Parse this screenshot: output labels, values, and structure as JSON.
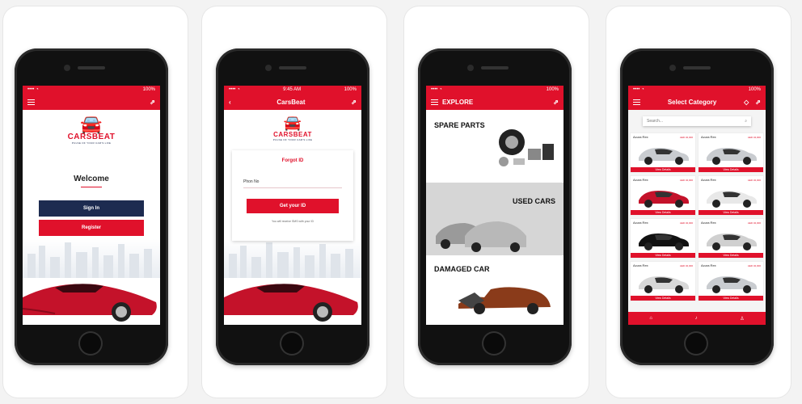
{
  "status": {
    "time": "9:45 AM",
    "battery": "100%"
  },
  "screen1": {
    "brand": "CARSBEAT",
    "tagline": "PULSE OF YOUR CAR'S LIFE",
    "welcome": "Welcome",
    "sign_in": "Sign In",
    "register": "Register"
  },
  "screen2": {
    "title": "CarsBeat",
    "form_title": "Forgot ID",
    "phone_placeholder": "Phon No",
    "submit": "Get your ID",
    "note": "You will receive SMS with your ID"
  },
  "screen3": {
    "title": "EXPLORE",
    "spare": "SPARE PARTS",
    "used": "USED CARS",
    "damaged": "DAMAGED CAR"
  },
  "screen4": {
    "title": "Select Category",
    "search_placeholder": "Search...",
    "view_label": "View Details",
    "cars": [
      {
        "name": "Acura Rex",
        "price": "AED 32,000",
        "color": "#c9ccd0"
      },
      {
        "name": "Acura Rex",
        "price": "AED 34,000",
        "color": "#c9ccd0"
      },
      {
        "name": "Acura Rex",
        "price": "AED 32,000",
        "color": "#c4122a"
      },
      {
        "name": "Acura Rex",
        "price": "AED 32,000",
        "color": "#e8e8e8"
      },
      {
        "name": "Acura Rex",
        "price": "AED 32,000",
        "color": "#111111"
      },
      {
        "name": "Acura Rex",
        "price": "AED 32,000",
        "color": "#d0d0d0"
      },
      {
        "name": "Acura Rex",
        "price": "AED 32,000",
        "color": "#d8d8d8"
      },
      {
        "name": "Acura Rex",
        "price": "AED 32,000",
        "color": "#c9ccd0"
      }
    ]
  },
  "colors": {
    "accent": "#e0112b",
    "navy": "#1d2b50"
  }
}
